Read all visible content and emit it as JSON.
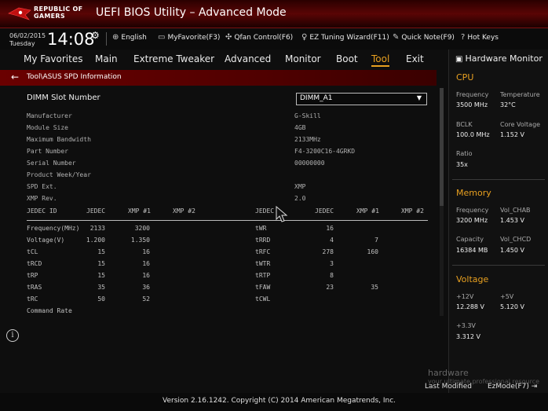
{
  "header": {
    "logo_line1": "REPUBLIC OF",
    "logo_line2": "GAMERS",
    "title": "UEFI BIOS Utility – Advanced Mode"
  },
  "infobar": {
    "date": "06/02/2015",
    "day": "Tuesday",
    "time": "14:08",
    "language": "English",
    "myfavorite": "MyFavorite(F3)",
    "qfan": "Qfan Control(F6)",
    "ez_tuning": "EZ Tuning Wizard(F11)",
    "quick_note": "Quick Note(F9)",
    "hot_keys": "Hot Keys"
  },
  "tabs": [
    {
      "label": "My Favorites"
    },
    {
      "label": "Main"
    },
    {
      "label": "Extreme Tweaker"
    },
    {
      "label": "Advanced"
    },
    {
      "label": "Monitor"
    },
    {
      "label": "Boot"
    },
    {
      "label": "Tool"
    },
    {
      "label": "Exit"
    }
  ],
  "active_tab": "Tool",
  "path": "Tool\\ASUS SPD Information",
  "dimm": {
    "label": "DIMM Slot Number",
    "selected": "DIMM_A1"
  },
  "spd_info": [
    {
      "label": "Manufacturer",
      "value": "G-Skill"
    },
    {
      "label": "Module Size",
      "value": "4GB"
    },
    {
      "label": "Maximum Bandwidth",
      "value": "2133MHz"
    },
    {
      "label": "Part Number",
      "value": "F4-3200C16-4GRKD"
    },
    {
      "label": "Serial Number",
      "value": "00000000"
    },
    {
      "label": "Product Week/Year",
      "value": ""
    },
    {
      "label": "SPD Ext.",
      "value": "XMP"
    },
    {
      "label": "XMP Rev.",
      "value": "2.0"
    }
  ],
  "timing_headers": {
    "left": [
      "JEDEC ID",
      "JEDEC",
      "XMP #1",
      "XMP #2"
    ],
    "right": [
      "JEDEC",
      "JEDEC",
      "XMP #1",
      "XMP #2"
    ]
  },
  "timings_left": [
    {
      "name": "Frequency(MHz)",
      "jedec": "2133",
      "xmp1": "3200",
      "xmp2": ""
    },
    {
      "name": "Voltage(V)",
      "jedec": "1.200",
      "xmp1": "1.350",
      "xmp2": ""
    },
    {
      "name": "tCL",
      "jedec": "15",
      "xmp1": "16",
      "xmp2": ""
    },
    {
      "name": "tRCD",
      "jedec": "15",
      "xmp1": "16",
      "xmp2": ""
    },
    {
      "name": "tRP",
      "jedec": "15",
      "xmp1": "16",
      "xmp2": ""
    },
    {
      "name": "tRAS",
      "jedec": "35",
      "xmp1": "36",
      "xmp2": ""
    },
    {
      "name": "tRC",
      "jedec": "50",
      "xmp1": "52",
      "xmp2": ""
    },
    {
      "name": "Command Rate",
      "jedec": "",
      "xmp1": "",
      "xmp2": ""
    }
  ],
  "timings_right": [
    {
      "name": "tWR",
      "jedec": "16",
      "xmp1": "",
      "xmp2": ""
    },
    {
      "name": "tRRD",
      "jedec": "4",
      "xmp1": "7",
      "xmp2": ""
    },
    {
      "name": "tRFC",
      "jedec": "278",
      "xmp1": "160",
      "xmp2": ""
    },
    {
      "name": "tWTR",
      "jedec": "3",
      "xmp1": "",
      "xmp2": ""
    },
    {
      "name": "tRTP",
      "jedec": "8",
      "xmp1": "",
      "xmp2": ""
    },
    {
      "name": "tFAW",
      "jedec": "23",
      "xmp1": "35",
      "xmp2": ""
    },
    {
      "name": "tCWL",
      "jedec": "",
      "xmp1": "",
      "xmp2": ""
    }
  ],
  "hw_monitor": {
    "title": "Hardware Monitor",
    "cpu_title": "CPU",
    "cpu": {
      "freq_label": "Frequency",
      "freq": "3500 MHz",
      "temp_label": "Temperature",
      "temp": "32°C",
      "bclk_label": "BCLK",
      "bclk": "100.0 MHz",
      "vcore_label": "Core Voltage",
      "vcore": "1.152 V",
      "ratio_label": "Ratio",
      "ratio": "35x"
    },
    "memory_title": "Memory",
    "memory": {
      "freq_label": "Frequency",
      "freq": "3200 MHz",
      "chab_label": "Vol_CHAB",
      "chab": "1.453 V",
      "cap_label": "Capacity",
      "cap": "16384 MB",
      "chcd_label": "Vol_CHCD",
      "chcd": "1.450 V"
    },
    "voltage_title": "Voltage",
    "voltage": {
      "v12_label": "+12V",
      "v12": "12.288 V",
      "v5_label": "+5V",
      "v5": "5.120 V",
      "v33_label": "+3.3V",
      "v33": "3.312 V"
    }
  },
  "footer": {
    "version": "Version 2.16.1242. Copyright (C) 2014 American Megatrends, Inc.",
    "last_modified": "Last Modified",
    "ez_mode": "EzMode(F7)"
  },
  "watermark": {
    "line1": "hardware",
    "line2": "your ultimate professional resource"
  },
  "colors": {
    "accent": "#e8a020",
    "header_red": "#5a0505",
    "path_red": "#6a0000"
  }
}
